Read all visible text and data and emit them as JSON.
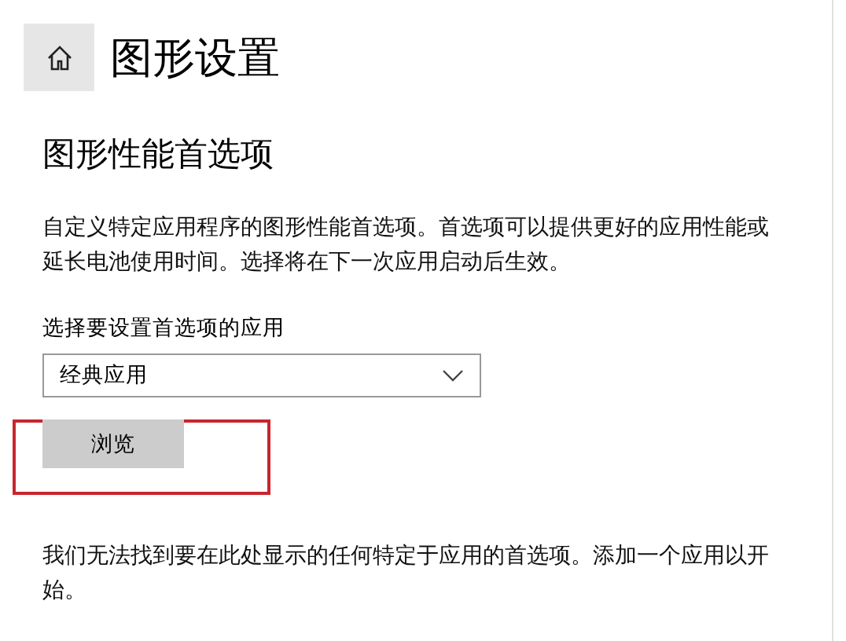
{
  "header": {
    "title": "图形设置"
  },
  "section_heading": "图形性能首选项",
  "description": "自定义特定应用程序的图形性能首选项。首选项可以提供更好的应用性能或延长电池使用时间。选择将在下一次应用启动后生效。",
  "app_picker": {
    "label": "选择要设置首选项的应用",
    "value": "经典应用"
  },
  "browse_button": {
    "label": "浏览",
    "highlighted": true
  },
  "empty_message": "我们无法找到要在此处显示的任何特定于应用的首选项。添加一个应用以开始。"
}
